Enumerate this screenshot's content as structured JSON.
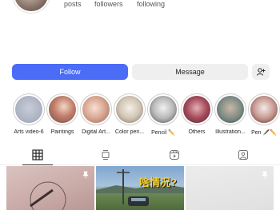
{
  "stats": {
    "posts": "posts",
    "followers": "followers",
    "following": "following"
  },
  "actions": {
    "follow": "Follow",
    "message": "Message"
  },
  "highlights": [
    {
      "label": "Arts video-6"
    },
    {
      "label": "Paintings"
    },
    {
      "label": "Digital Art..."
    },
    {
      "label": "Color pen..."
    },
    {
      "label": "Pencil ✏️"
    },
    {
      "label": "Others"
    },
    {
      "label": "Illustration..."
    },
    {
      "label": "Pen 🖋️✏️"
    }
  ],
  "tabs": [
    "posts-grid",
    "reels",
    "videos",
    "tagged"
  ],
  "posts": [
    {
      "caption": ""
    },
    {
      "caption": "啥情况?"
    },
    {
      "caption": ""
    }
  ],
  "colors": {
    "accent": "#4a6cf7",
    "secondary_button": "#efefef"
  }
}
